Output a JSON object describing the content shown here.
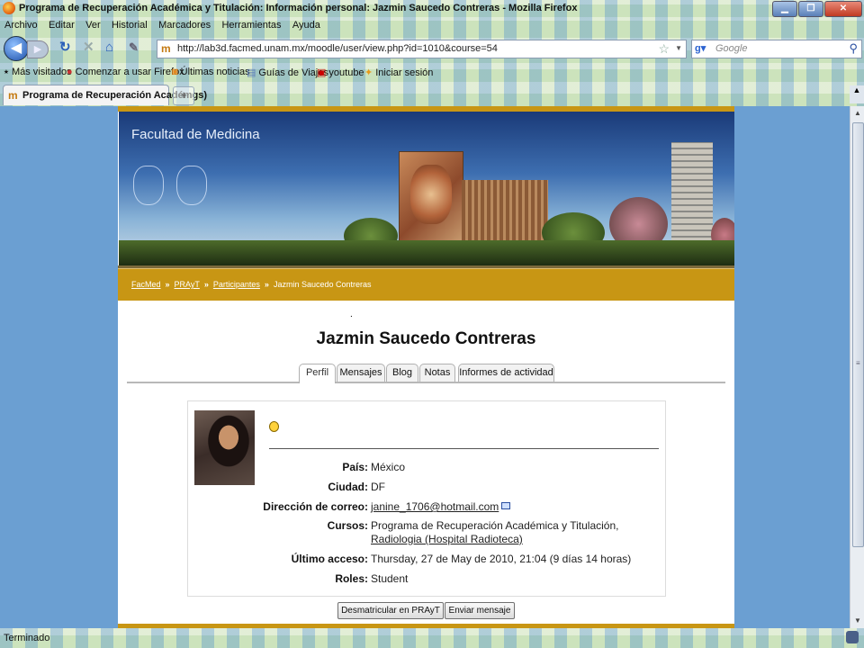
{
  "window": {
    "title": "Programa de Recuperación Académica y Titulación: Información personal: Jazmin Saucedo Contreras - Mozilla Firefox",
    "controls": {
      "minimize": "▁",
      "maximize": "❐",
      "close": "✕"
    }
  },
  "menu": [
    "Archivo",
    "Editar",
    "Ver",
    "Historial",
    "Marcadores",
    "Herramientas",
    "Ayuda"
  ],
  "nav": {
    "url": "http://lab3d.facmed.unam.mx/moodle/user/view.php?id=1010&course=54",
    "search_placeholder": "Google"
  },
  "bookmarks": [
    "Más visitados",
    "Comenzar a usar Firefox",
    "Últimas noticias",
    "Guías de Viajes",
    "youtube",
    "Iniciar sesión"
  ],
  "tab": {
    "label": "Programa de Recuperación Académgs)",
    "new_tab": "+"
  },
  "site": {
    "banner_title": "Facultad de Medicina",
    "breadcrumb": [
      "FacMed",
      "PRAyT",
      "Participantes",
      "Jazmin Saucedo Contreras"
    ],
    "breadcrumb_sep": "»"
  },
  "profile": {
    "name": "Jazmin Saucedo Contreras",
    "tabs": [
      "Perfil",
      "Mensajes",
      "Blog",
      "Notas",
      "Informes de actividad"
    ],
    "active_tab": "Perfil",
    "fields": {
      "pais_label": "País:",
      "pais": "México",
      "ciudad_label": "Ciudad:",
      "ciudad": "DF",
      "email_label": "Dirección de correo:",
      "email": "janine_1706@hotmail.com",
      "cursos_label": "Cursos:",
      "cursos_prefix": "Programa de Recuperación Académica y Titulación,",
      "cursos_link": "Radiologia (Hospital Radioteca)",
      "acceso_label": "Último acceso:",
      "acceso": "Thursday, 27 de May de 2010, 21:04  (9 días 14 horas)",
      "roles_label": "Roles:",
      "roles": "Student"
    },
    "buttons": {
      "unenrol": "Desmatricular en PRAyT",
      "message": "Enviar mensaje"
    }
  },
  "status": {
    "text": "Terminado"
  }
}
